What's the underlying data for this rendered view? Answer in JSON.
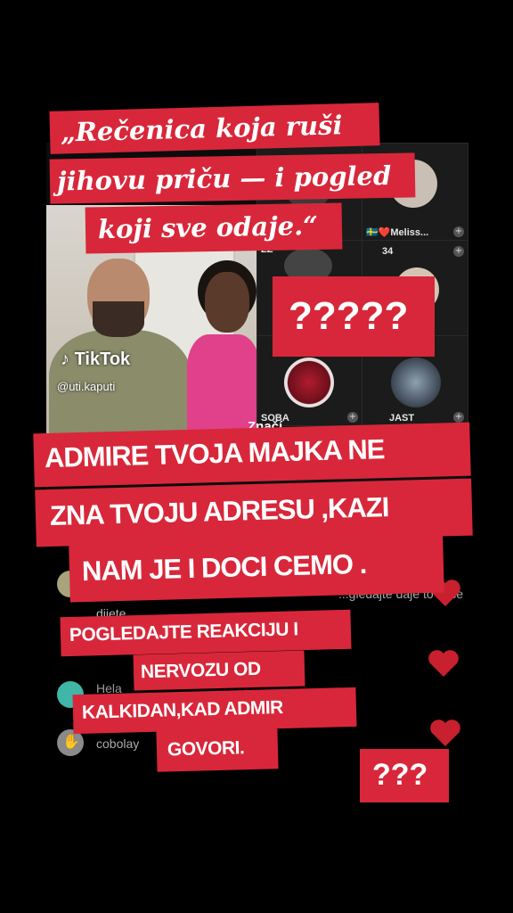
{
  "video": {
    "watermark": "TikTok",
    "username": "@uti.kaputi",
    "partial_caption": "Značí"
  },
  "live_grid": {
    "tiles": [
      {
        "name": "",
        "color": "#2c2c2c"
      },
      {
        "name": "🇸🇪❤️Meliss...",
        "color": "#333"
      },
      {
        "name": "ZZ",
        "color": "#222"
      },
      {
        "name": "34",
        "color": "#2a2a2a"
      },
      {
        "name": "SOBA",
        "color": "#1f1f1f"
      },
      {
        "name": "JAST",
        "color": "#1f1f1f"
      }
    ]
  },
  "comments": [
    {
      "text": "...gledajte daje to vaše",
      "continuation": "dijete",
      "avatar_color": "#a8a37a"
    },
    {
      "text": "Hela",
      "avatar_color": "#3fb6a8"
    },
    {
      "text": "cobolay",
      "avatar_color": "#8a8a8a"
    }
  ],
  "overlays": {
    "quote_line1": "„Rečenica koja ruši",
    "quote_line2": "jihovu priču — i pogled",
    "quote_line3": "koji sve odaje.“",
    "q5": "?????",
    "main_line1": "ADMIRE TVOJA MAJKA NE",
    "main_line2": "ZNA TVOJU ADRESU ,KAZI",
    "main_line3": "NAM JE I DOCI CEMO .",
    "sub_line1": "POGLEDAJTE REAKCIJU I",
    "sub_line2": "NERVOZU OD",
    "sub_line3": "KALKIDAN,KAD ADMIR",
    "sub_line4": "GOVORI.",
    "q3": "???"
  },
  "colors": {
    "banner": "#d8273a",
    "heart": "#c8202e"
  }
}
